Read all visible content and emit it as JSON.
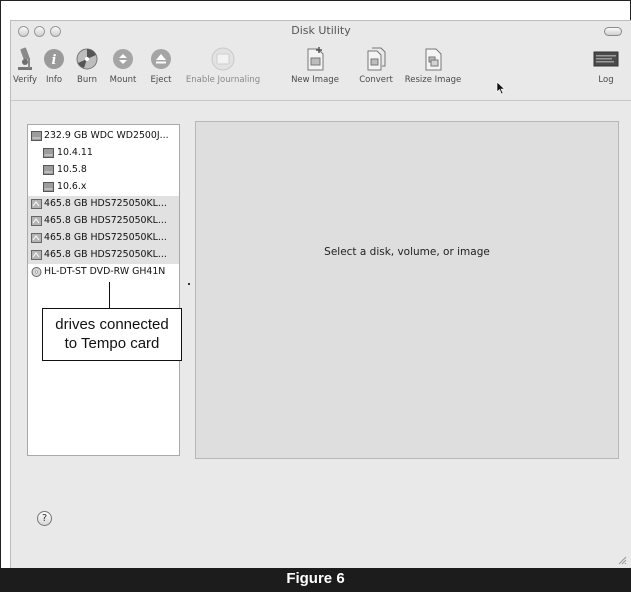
{
  "window": {
    "title": "Disk Utility"
  },
  "toolbar": [
    {
      "label": "Verify",
      "icon": "microscope-icon"
    },
    {
      "label": "Info",
      "icon": "info-icon"
    },
    {
      "label": "Burn",
      "icon": "burn-icon"
    },
    {
      "label": "Mount",
      "icon": "mount-icon"
    },
    {
      "label": "Eject",
      "icon": "eject-icon"
    },
    {
      "label": "Enable Journaling",
      "icon": "journal-icon"
    },
    {
      "label": "New Image",
      "icon": "new-image-icon"
    },
    {
      "label": "Convert",
      "icon": "convert-icon"
    },
    {
      "label": "Resize Image",
      "icon": "resize-image-icon"
    },
    {
      "label": "Log",
      "icon": "log-icon"
    }
  ],
  "sidebar": {
    "items": [
      {
        "label": "232.9 GB WDC WD2500J...",
        "kind": "disk"
      },
      {
        "label": "10.4.11",
        "kind": "volume"
      },
      {
        "label": "10.5.8",
        "kind": "volume"
      },
      {
        "label": "10.6.x",
        "kind": "volume"
      },
      {
        "label": "465.8 GB HDS725050KL...",
        "kind": "external"
      },
      {
        "label": "465.8 GB HDS725050KL...",
        "kind": "external"
      },
      {
        "label": "465.8 GB HDS725050KL...",
        "kind": "external"
      },
      {
        "label": "465.8 GB HDS725050KL...",
        "kind": "external"
      },
      {
        "label": "HL-DT-ST DVD-RW GH41N",
        "kind": "optical"
      }
    ]
  },
  "detail": {
    "message": "Select a disk, volume, or image"
  },
  "callout": {
    "line1": "drives connected",
    "line2": "to Tempo card"
  },
  "figure": {
    "label": "Figure 6"
  }
}
